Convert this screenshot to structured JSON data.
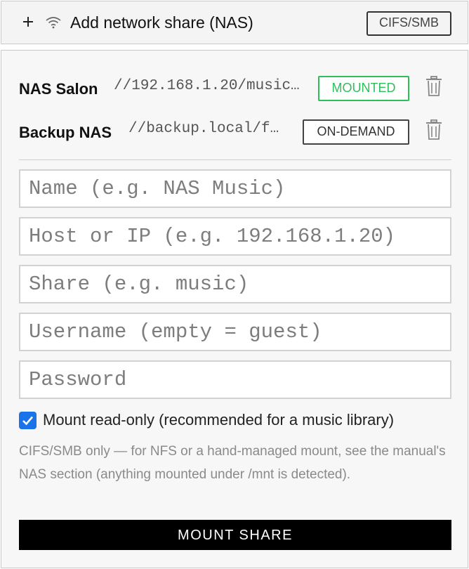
{
  "header": {
    "title": "Add network share (NAS)",
    "protocol_badge": "CIFS/SMB",
    "icons": [
      "plus-icon",
      "wifi-icon"
    ]
  },
  "shares": [
    {
      "name": "NAS Salon",
      "path": "//192.168.1.20/music…",
      "status": "MOUNTED",
      "status_color": "#2dbf5a"
    },
    {
      "name": "Backup NAS",
      "path": "//backup.local/f…",
      "status": "ON-DEMAND",
      "status_color": "#444444"
    }
  ],
  "form": {
    "name_placeholder": "Name (e.g. NAS Music)",
    "host_placeholder": "Host or IP (e.g. 192.168.1.20)",
    "share_placeholder": "Share (e.g. music)",
    "username_placeholder": "Username (empty = guest)",
    "password_placeholder": "Password",
    "readonly_label": "Mount read-only (recommended for a music library)",
    "readonly_checked": true,
    "note": "CIFS/SMB only — for NFS or a hand-managed mount, see the manual's NAS section (anything mounted under /mnt is detected).",
    "submit_label": "MOUNT SHARE"
  },
  "colors": {
    "accent": "#1a73e8",
    "mounted": "#2dbf5a",
    "button_bg": "#000000"
  }
}
